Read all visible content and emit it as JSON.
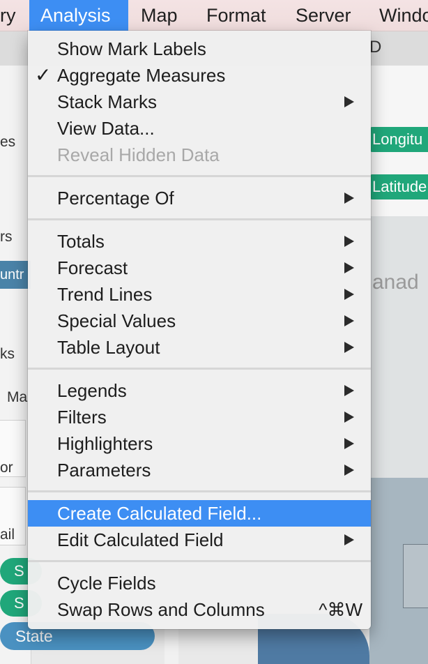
{
  "menubar": {
    "items": [
      "ry",
      "Analysis",
      "Map",
      "Format",
      "Server",
      "Windo"
    ],
    "active_index": 1
  },
  "background": {
    "left_labels": [
      "es",
      "rs",
      "ks",
      "Ma",
      "or",
      "ail"
    ],
    "country_tab": "untr",
    "pills": [
      "Longitu",
      "Latitude"
    ],
    "map_label": "anad",
    "title_fragment": "D",
    "shelf_pills": [
      "S",
      "S"
    ],
    "state_pill": "State"
  },
  "menu": {
    "items": [
      {
        "label": "Show Mark Labels",
        "checked": false,
        "submenu": false,
        "disabled": false
      },
      {
        "label": "Aggregate Measures",
        "checked": true,
        "submenu": false,
        "disabled": false
      },
      {
        "label": "Stack Marks",
        "checked": false,
        "submenu": true,
        "disabled": false
      },
      {
        "label": "View Data...",
        "checked": false,
        "submenu": false,
        "disabled": false
      },
      {
        "label": "Reveal Hidden Data",
        "checked": false,
        "submenu": false,
        "disabled": true
      },
      {
        "label": "Percentage Of",
        "checked": false,
        "submenu": true,
        "disabled": false
      },
      {
        "label": "Totals",
        "checked": false,
        "submenu": true,
        "disabled": false
      },
      {
        "label": "Forecast",
        "checked": false,
        "submenu": true,
        "disabled": false
      },
      {
        "label": "Trend Lines",
        "checked": false,
        "submenu": true,
        "disabled": false
      },
      {
        "label": "Special Values",
        "checked": false,
        "submenu": true,
        "disabled": false
      },
      {
        "label": "Table Layout",
        "checked": false,
        "submenu": true,
        "disabled": false
      },
      {
        "label": "Legends",
        "checked": false,
        "submenu": true,
        "disabled": false
      },
      {
        "label": "Filters",
        "checked": false,
        "submenu": true,
        "disabled": false
      },
      {
        "label": "Highlighters",
        "checked": false,
        "submenu": true,
        "disabled": false
      },
      {
        "label": "Parameters",
        "checked": false,
        "submenu": true,
        "disabled": false
      },
      {
        "label": "Create Calculated Field...",
        "checked": false,
        "submenu": false,
        "disabled": false,
        "highlighted": true
      },
      {
        "label": "Edit Calculated Field",
        "checked": false,
        "submenu": true,
        "disabled": false
      },
      {
        "label": "Cycle Fields",
        "checked": false,
        "submenu": false,
        "disabled": false
      },
      {
        "label": "Swap Rows and Columns",
        "checked": false,
        "submenu": false,
        "disabled": false,
        "shortcut": "^⌘W"
      }
    ]
  },
  "colors": {
    "menu_highlight": "#3d8ef3",
    "pill_green": "#20a77a",
    "pill_blue": "#4a91c1"
  }
}
